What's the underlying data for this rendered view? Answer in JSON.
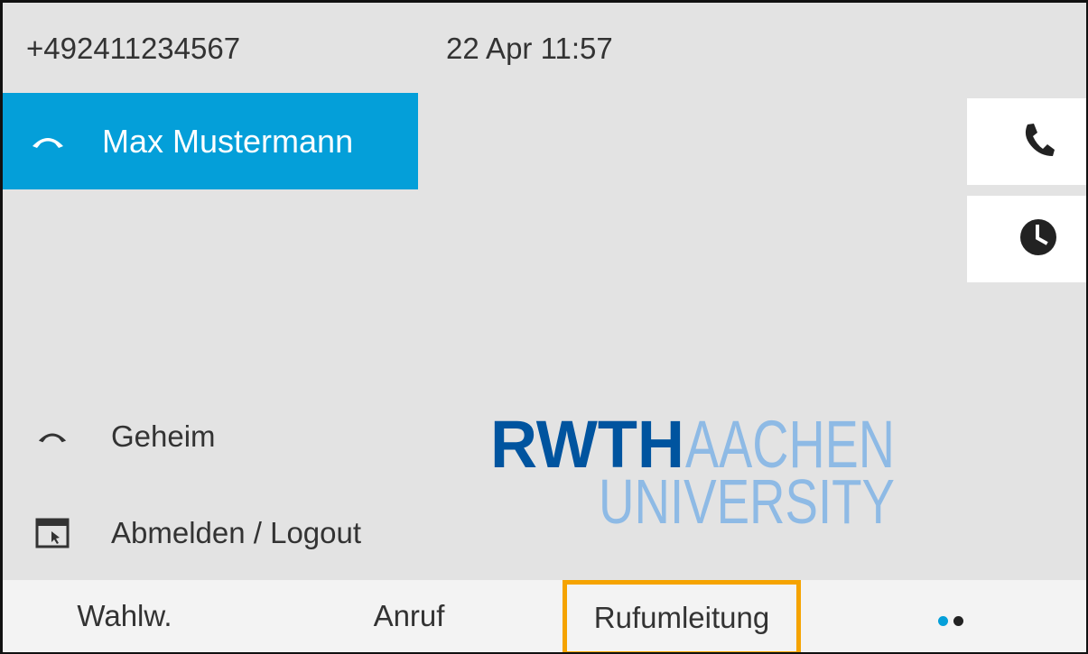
{
  "status": {
    "number": "+492411234567",
    "datetime": "22 Apr 11:57"
  },
  "lines": {
    "active": {
      "label": "Max Mustermann",
      "icon": "handset-icon"
    },
    "items": [
      {
        "label": "Geheim",
        "icon": "handset-icon"
      },
      {
        "label": "Abmelden / Logout",
        "icon": "app-window-icon"
      }
    ]
  },
  "side_buttons": [
    {
      "icon": "phone-icon"
    },
    {
      "icon": "clock-icon"
    }
  ],
  "logo": {
    "line1_dark": "RWTH",
    "line1_light": "AACHEN",
    "line2": "UNIVERSITY"
  },
  "softkeys": [
    {
      "label": "Wahlw."
    },
    {
      "label": "Anruf"
    },
    {
      "label": "Rufumleitung",
      "highlighted": true
    },
    {
      "label": "",
      "icon": "page-dots-icon"
    }
  ],
  "colors": {
    "accent": "#049fd9",
    "highlight_border": "#f5a300",
    "logo_dark": "#00549f",
    "logo_light": "#8ebae5",
    "page_dot_active": "#049fd9",
    "page_dot_inactive": "#222222"
  }
}
